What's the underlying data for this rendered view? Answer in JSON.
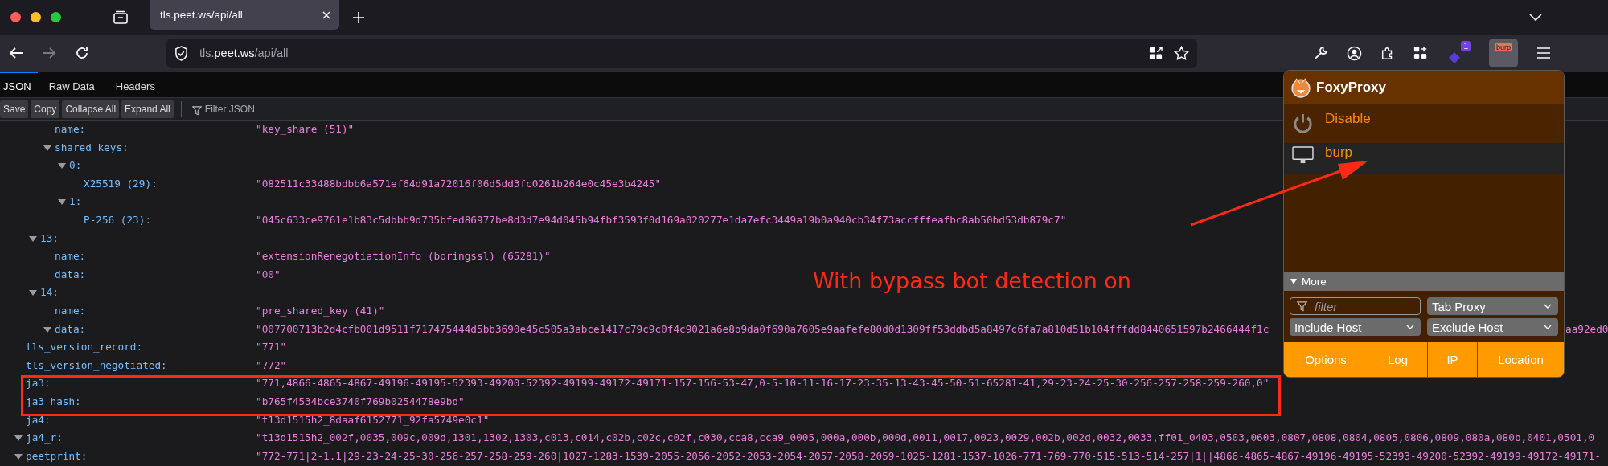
{
  "tabs": [
    {
      "title": "tls.peet.ws/api/all",
      "selected": true
    }
  ],
  "nav_buttons": [
    {
      "kind": "back",
      "disabled": false
    },
    {
      "kind": "forward",
      "disabled": true
    },
    {
      "kind": "reload",
      "disabled": false
    }
  ],
  "address_bar": {
    "subdomain": "tls.",
    "domain": "peet.ws",
    "path": "/api/all"
  },
  "toolbar": {
    "extension_badge": "1",
    "proxy_button_label": "burp"
  },
  "viewer_tabs": [
    {
      "label": "JSON",
      "selected": true
    },
    {
      "label": "Raw Data",
      "selected": false
    },
    {
      "label": "Headers",
      "selected": false
    }
  ],
  "viewer_toolbar": {
    "buttons": [
      "Save",
      "Copy",
      "Collapse All",
      "Expand All"
    ],
    "filter_placeholder": "Filter JSON"
  },
  "tree": [
    {
      "children": [
        {
          "children": [
            {
              "key": "name:",
              "value": "\"key_share (51)\""
            },
            {
              "key": "shared_keys:",
              "expanded": true,
              "children": [
                {
                  "key": "0:",
                  "expanded": true,
                  "children": [
                    {
                      "key": "X25519 (29):",
                      "value": "\"082511c33488bdbb6a571ef64d91a72016f06d5dd3fc0261b264e0c45e3b4245\""
                    }
                  ]
                },
                {
                  "key": "1:",
                  "expanded": true,
                  "children": [
                    {
                      "key": "P-256 (23):",
                      "value": "\"045c633ce9761e1b83c5dbbb9d735bfed86977be8d3d7e94d045b94fbf3593f0d169a020277e1da7efc3449a19b0a940cb34f73accfffeafbc8ab50bd53db879c7\""
                    }
                  ]
                }
              ]
            }
          ]
        },
        {
          "key": "13:",
          "expanded": true,
          "children": [
            {
              "key": "name:",
              "value": "\"extensionRenegotiationInfo (boringssl) (65281)\""
            },
            {
              "key": "data:",
              "value": "\"00\""
            }
          ]
        },
        {
          "key": "14:",
          "expanded": true,
          "children": [
            {
              "key": "name:",
              "value": "\"pre_shared_key (41)\""
            },
            {
              "key": "data:",
              "expanded": true,
              "value": "\"007700713b2d4cfb001d9511f717475444d5bb3690e45c505a3abce1417c79c9c0f4c9021a6e8b9da0f690a7605e9aafefe80d0d1309ff53ddbd5a8497c6fa7a810d51b104fffdd8440651597b2466444f1c",
              "value_after_popup": "aa92ed0"
            }
          ]
        }
      ]
    },
    {
      "key": "tls_version_record:",
      "value": "\"771\""
    },
    {
      "key": "tls_version_negotiated:",
      "value": "\"772\""
    },
    {
      "key": "ja3:",
      "value": "\"771,4866-4865-4867-49196-49195-52393-49200-52392-49199-49172-49171-157-156-53-47,0-5-10-11-16-17-23-35-13-43-45-50-51-65281-41,29-23-24-25-30-256-257-258-259-260,0\""
    },
    {
      "key": "ja3_hash:",
      "value": "\"b765f4534bce3740f769b0254478e9bd\""
    },
    {
      "key": "ja4:",
      "value": "\"t13d1515h2_8daaf6152771_92fa5749e0c1\""
    },
    {
      "key": "ja4_r:",
      "expanded": true,
      "value": "\"t13d1515h2_002f,0035,009c,009d,1301,1302,1303,c013,c014,c02b,c02c,c02f,c030,cca8,cca9_0005,000a,000b,000d,0011,0017,0023,0029,002b,002d,0032,0033,ff01_0403,0503,0603,0807,0808,0804,0805,0806,0809,080a,080b,0401,0501,0"
    },
    {
      "key": "peetprint:",
      "expanded": true,
      "value": "\"772-771|2-1.1|29-23-24-25-30-256-257-258-259-260|1027-1283-1539-2055-2056-2052-2053-2054-2057-2058-2059-1025-1281-1537-1026-771-769-770-515-513-514-257|1||4866-4865-4867-49196-49195-52393-49200-52392-49199-49172-49171-"
    }
  ],
  "annotation": {
    "text": "With bypass bot detection on"
  },
  "foxyproxy": {
    "title": "FoxyProxy",
    "items": [
      {
        "kind": "disable",
        "label": "Disable",
        "selected": false
      },
      {
        "kind": "proxy",
        "label": "burp",
        "selected": true
      }
    ],
    "more_label": "More",
    "more_expanded": true,
    "filter_placeholder": "filter",
    "selects": [
      "Tab Proxy",
      "Include Host",
      "Exclude Host"
    ],
    "buttons": [
      "Options",
      "Log",
      "IP",
      "Location"
    ]
  }
}
